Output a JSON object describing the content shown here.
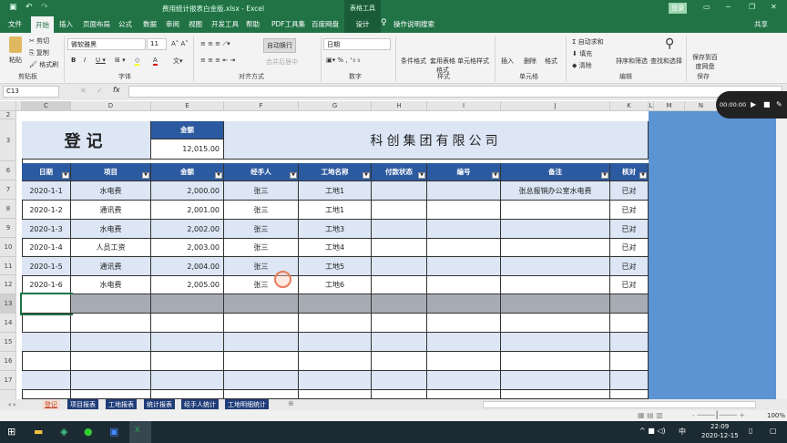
{
  "titlebar": {
    "filename": "费用统计报表白金版.xlsx - Excel",
    "context_tab": "表格工具",
    "login": "登录"
  },
  "tabs": [
    "文件",
    "开始",
    "插入",
    "页面布局",
    "公式",
    "数据",
    "审阅",
    "视图",
    "开发工具",
    "帮助",
    "PDF工具集",
    "百度网盘",
    "设计"
  ],
  "tell_me": "操作说明搜索",
  "share": "共享",
  "ribbon": {
    "paste": "粘贴",
    "cut": "剪切",
    "copy": "复制",
    "format_painter": "格式刷",
    "clipboard": "剪贴板",
    "font_name": "微软雅黑",
    "font_size": "11",
    "font_group": "字体",
    "wrap": "自动换行",
    "merge": "合并后居中",
    "align_group": "对齐方式",
    "number_format": "日期",
    "number_group": "数字",
    "cond_format": "条件格式",
    "table_format": "套用表格格式",
    "cell_style": "单元格样式",
    "styles_group": "样式",
    "insert": "插入",
    "delete": "删除",
    "format": "格式",
    "cells_group": "单元格",
    "autosum": "自动求和",
    "fill": "填充",
    "clear": "清除",
    "sort": "排序和筛选",
    "find": "查找和选择",
    "edit_group": "编辑",
    "save_baidu": "保存到百度网盘",
    "save_group": "保存"
  },
  "formula_bar": {
    "name_box": "C13",
    "formula": ""
  },
  "recorder": {
    "time": "00:00:00"
  },
  "columns": [
    "C",
    "D",
    "E",
    "F",
    "G",
    "H",
    "I",
    "J",
    "K",
    "L",
    "M",
    "N"
  ],
  "rows": [
    "2",
    "3",
    "6",
    "7",
    "8",
    "9",
    "10",
    "11",
    "12",
    "13",
    "14",
    "15",
    "16",
    "17"
  ],
  "sheet": {
    "title": "登记",
    "amount_label": "金额",
    "amount_value": "12,015.00",
    "company": "科创集团有限公司",
    "headers": [
      "日期",
      "项目",
      "金额",
      "经手人",
      "工地名称",
      "付款状态",
      "编号",
      "备注",
      "核对"
    ],
    "data": [
      [
        "2020-1-1",
        "水电费",
        "2,000.00",
        "张三",
        "工地1",
        "",
        "",
        "张总报销办公室水电费",
        "已对"
      ],
      [
        "2020-1-2",
        "通讯费",
        "2,001.00",
        "张三",
        "工地1",
        "",
        "",
        "",
        "已对"
      ],
      [
        "2020-1-3",
        "水电费",
        "2,002.00",
        "张三",
        "工地3",
        "",
        "",
        "",
        "已对"
      ],
      [
        "2020-1-4",
        "人员工资",
        "2,003.00",
        "张三",
        "工地4",
        "",
        "",
        "",
        "已对"
      ],
      [
        "2020-1-5",
        "通讯费",
        "2,004.00",
        "张三",
        "工地5",
        "",
        "",
        "",
        "已对"
      ],
      [
        "2020-1-6",
        "水电费",
        "2,005.00",
        "张三",
        "工地6",
        "",
        "",
        "",
        "已对"
      ]
    ]
  },
  "sheet_tabs": [
    "登记",
    "项目报表",
    "工地报表",
    "统计报表",
    "经手人统计",
    "工地明细统计"
  ],
  "status": {
    "zoom": "100%"
  },
  "taskbar": {
    "time": "22:09",
    "date": "2020-12-15",
    "ime": "中"
  }
}
